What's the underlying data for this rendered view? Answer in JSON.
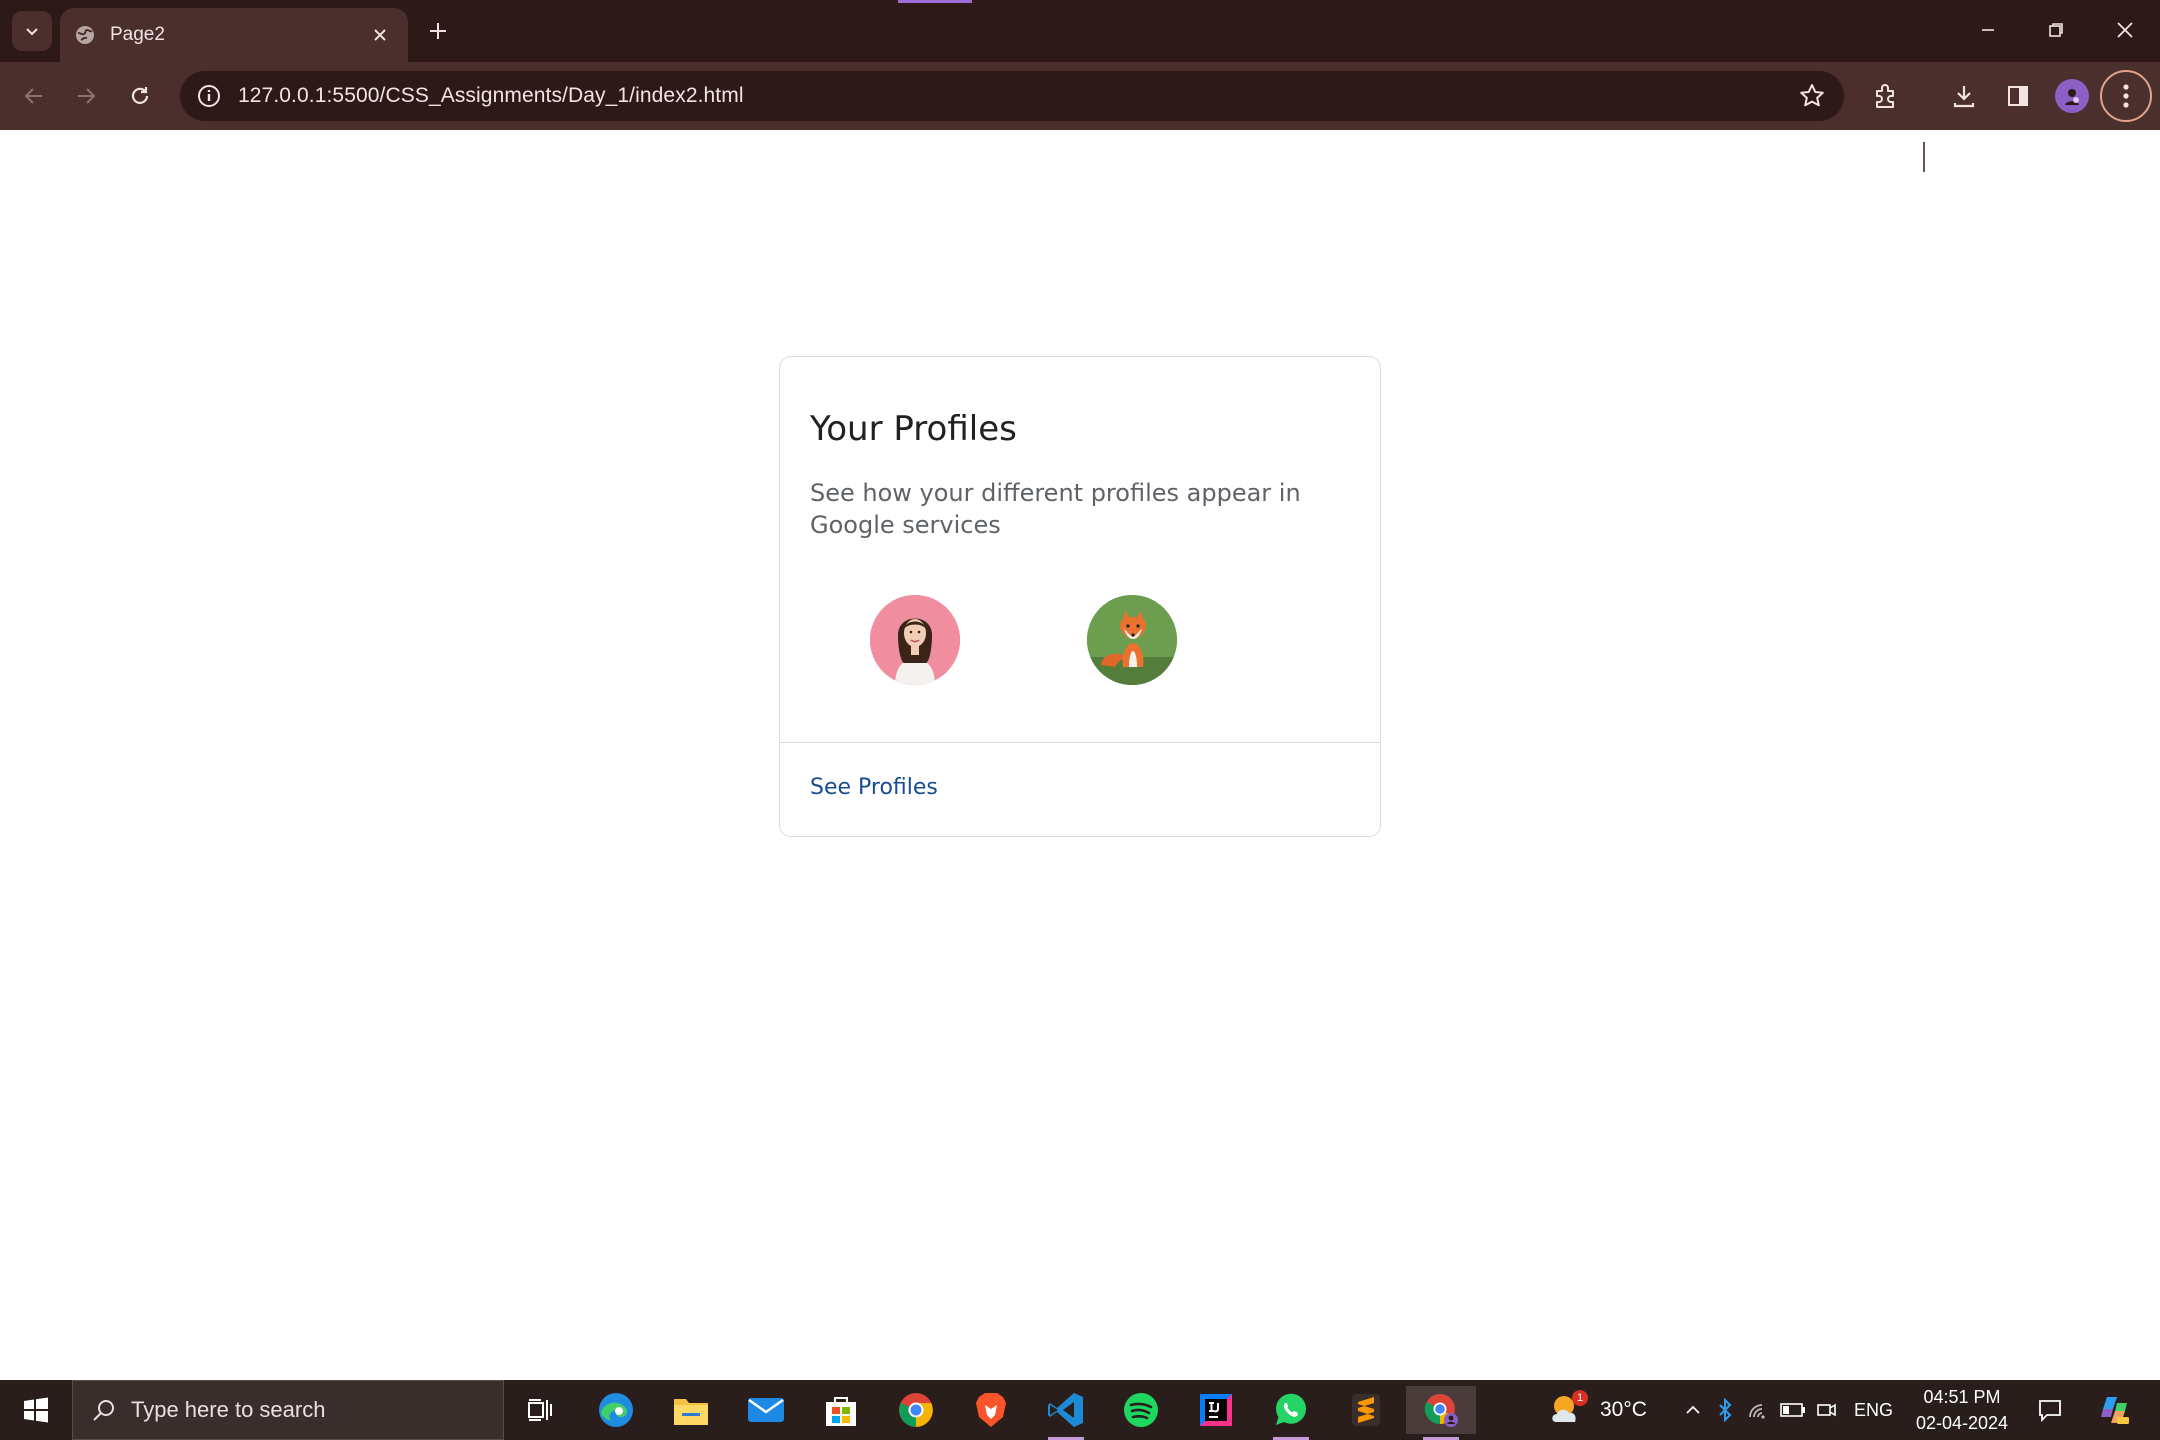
{
  "browser": {
    "tab_title": "Page2",
    "url": "127.0.0.1:5500/CSS_Assignments/Day_1/index2.html"
  },
  "card": {
    "title": "Your Profiles",
    "description": "See how your different profiles appear in Google services",
    "profiles": [
      {
        "name": "woman-profile",
        "bg": "#f08ea0"
      },
      {
        "name": "fox-profile",
        "bg": "#6d9e50"
      }
    ],
    "link_label": "See Profiles",
    "link_color": "#1a4d8f"
  },
  "taskbar": {
    "search_placeholder": "Type here to search",
    "weather_temp": "30°C",
    "weather_badge": "1",
    "language": "ENG",
    "time": "04:51 PM",
    "date": "02-04-2024"
  },
  "colors": {
    "chrome_dark": "#2d1918",
    "chrome_toolbar": "#4a2f2d",
    "taskbar_bg": "#2a1e1c"
  }
}
